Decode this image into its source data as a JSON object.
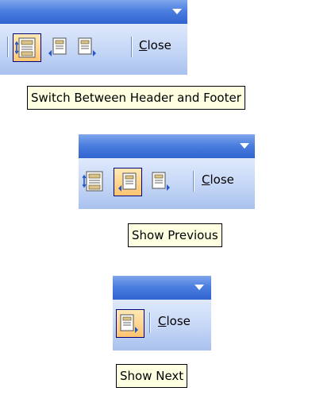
{
  "toolbar1": {
    "close_accel": "C",
    "close_rest": "lose",
    "tooltip": "Switch Between Header and Footer"
  },
  "toolbar2": {
    "close_accel": "C",
    "close_rest": "lose",
    "tooltip": "Show Previous"
  },
  "toolbar3": {
    "close_accel": "C",
    "close_rest": "lose",
    "tooltip": "Show Next"
  },
  "icons": {
    "switch": "switch-header-footer-icon",
    "previous": "show-previous-icon",
    "next": "show-next-icon",
    "dropdown": "toolbar-options-dropdown-icon"
  },
  "colors": {
    "title_bar": "#4d7fe0",
    "toolbar_body": "#c4d6f6",
    "active_button": "#ffc470",
    "tooltip_bg": "#ffffe1"
  }
}
